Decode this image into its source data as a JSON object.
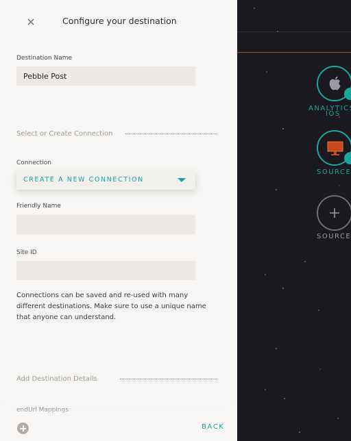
{
  "panel": {
    "title": "Configure your destination",
    "destination_name": {
      "label": "Destination Name",
      "value": "Pebble Post"
    },
    "section_connection": "Select or Create Connection",
    "connection": {
      "label": "Connection",
      "selected": "CREATE A NEW CONNECTION"
    },
    "friendly_name": {
      "label": "Friendly Name",
      "value": ""
    },
    "site_id": {
      "label": "Site ID",
      "value": ""
    },
    "help_text": "Connections can be saved and re-used with many different destinations. Make sure to use a unique name that anyone can understand.",
    "section_details": "Add Destination Details",
    "endurl_label": "endUrl Mappings",
    "footer": {
      "back_label": "BACK"
    }
  },
  "canvas": {
    "nodes": [
      {
        "icon": "apple-icon",
        "label": "ANALYTICS",
        "sublabel": "IOS"
      },
      {
        "icon": "monitor-icon",
        "label": "SOURCE"
      },
      {
        "icon": "plus-icon",
        "label": "SOURCE"
      }
    ]
  },
  "colors": {
    "accent": "#17a2a1",
    "node_ring": "#1aa79d",
    "canvas_bg": "#1b1920"
  }
}
